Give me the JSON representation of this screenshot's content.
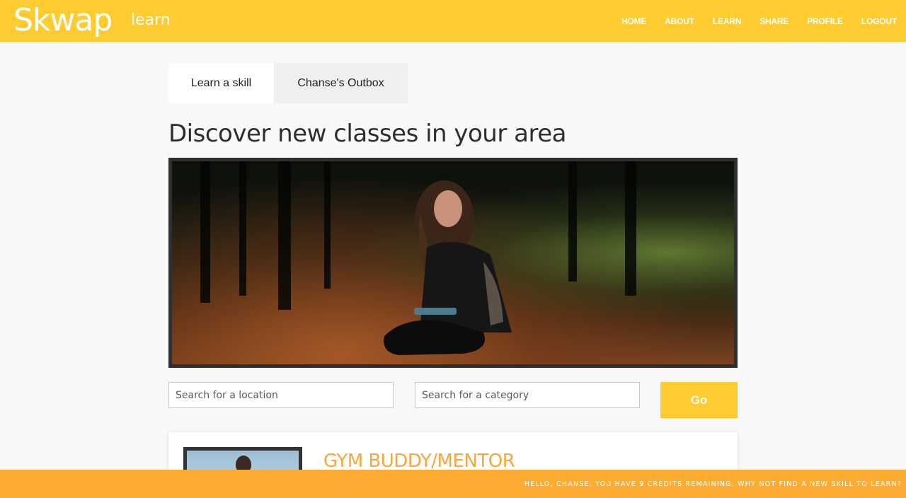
{
  "brand": {
    "name": "Skwap",
    "section": "learn"
  },
  "nav": {
    "items": [
      {
        "label": "HOME"
      },
      {
        "label": "ABOUT"
      },
      {
        "label": "LEARN"
      },
      {
        "label": "SHARE"
      },
      {
        "label": "PROFILE"
      },
      {
        "label": "LOGOUT"
      }
    ]
  },
  "tabs": [
    {
      "label": "Learn a skill",
      "active": true
    },
    {
      "label": "Chanse's Outbox",
      "active": false
    }
  ],
  "headline": "Discover new classes in your area",
  "search": {
    "location_placeholder": "Search for a location",
    "category_placeholder": "Search for a category",
    "go_label": "Go"
  },
  "listing": {
    "title": "GYM BUDDY/MENTOR"
  },
  "footer": {
    "message": "HELLO, CHANSE. YOU HAVE 9 CREDITS REMAINING. WHY NOT FIND A NEW SKILL TO LEARN?"
  },
  "colors": {
    "brand_yellow": "#fecc30",
    "footer_orange": "#fcac30",
    "listing_title": "#f6a83a"
  }
}
